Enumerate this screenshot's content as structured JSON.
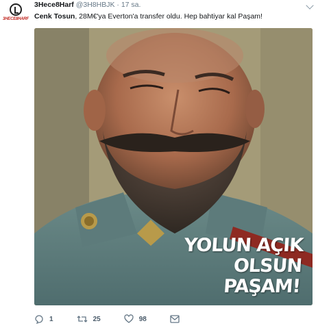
{
  "tweet": {
    "avatar_text": "3HECE8HARF",
    "display_name": "3Hece8Harf",
    "handle": "@3H8HBJK",
    "separator": "·",
    "time": "17 sa.",
    "mention": "Cenk Tosun",
    "body": ", 28M€'ya Everton'a transfer oldu. Hep bahtiyar kal Paşam!"
  },
  "media": {
    "caption_line1": "YOLUN AÇIK OLSUN",
    "caption_line2": "PAŞAM!"
  },
  "actions": {
    "reply_count": "1",
    "retweet_count": "25",
    "like_count": "98"
  },
  "icons": [
    "logo-icon",
    "caret-down-icon",
    "reply-icon",
    "retweet-icon",
    "like-icon",
    "message-icon"
  ],
  "colors": {
    "text": "#14171a",
    "secondary": "#657786",
    "brand_red": "#c0261f"
  }
}
